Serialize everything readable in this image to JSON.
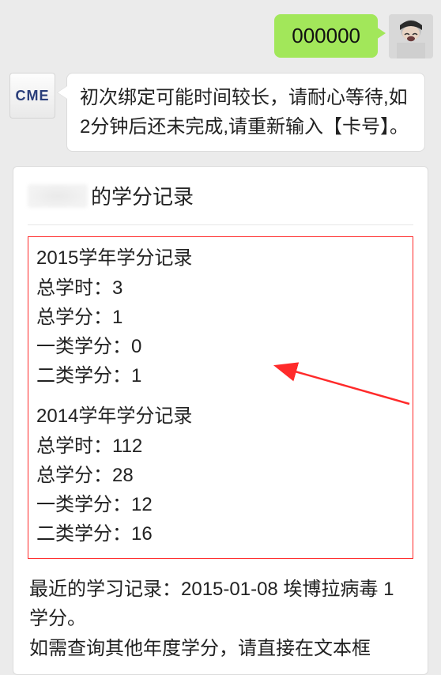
{
  "outgoing": {
    "text": "000000"
  },
  "cme": {
    "badge": "CME",
    "message": "初次绑定可能时间较长，请耐心等待,如2分钟后还未完成,请重新输入【卡号】。"
  },
  "card": {
    "title_suffix": "的学分记录",
    "records": [
      {
        "header": "2015学年学分记录",
        "lines": [
          "总学时：3",
          "总学分：1",
          "一类学分：0",
          "二类学分：1"
        ]
      },
      {
        "header": "2014学年学分记录",
        "lines": [
          "总学时：112",
          "总学分：28",
          "一类学分：12",
          "二类学分：16"
        ]
      }
    ],
    "footer_line1": "最近的学习记录：2015-01-08 埃博拉病毒 1学分。",
    "footer_line2": "如需查询其他年度学分，请直接在文本框"
  }
}
